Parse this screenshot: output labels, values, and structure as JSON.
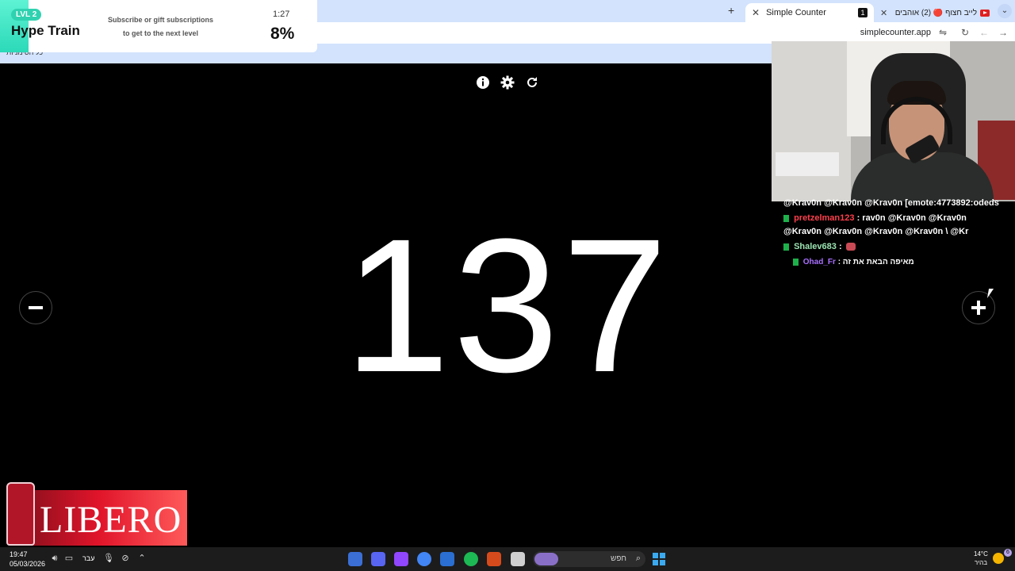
{
  "browser": {
    "new_tab_icon": "plus-icon",
    "tabs": [
      {
        "title": "Simple Counter",
        "favicon": "1"
      },
      {
        "title": "לייב חצוף 🔴 (2) אוהבים"
      }
    ],
    "url": "simplecounter.app",
    "bookmark": "כל הסימניות"
  },
  "hype_train": {
    "level": "LVL 2",
    "title": "Hype Train",
    "subtitle_line1": "Subscribe or gift subscriptions",
    "subtitle_line2": "to get to the next level",
    "timer": "1:27",
    "progress": "8%"
  },
  "counter": {
    "value": "137",
    "decrement_icon": "minus-icon",
    "increment_icon": "plus-icon",
    "toolbar_icons": [
      "info-icon",
      "gear-icon",
      "refresh-icon"
    ]
  },
  "chat": {
    "line1": "@Krav0n   @Krav0n   @Krav0n [emote:4773892:odeds",
    "line2_user": "pretzelman123",
    "line2_msg": ": rav0n   @Krav0n   @Krav0n  ",
    "line3": "@Krav0n   @Krav0n   @Krav0n   @Krav0n \\   @Kr",
    "line4_user": "Shalev683",
    "line4_msg": " : ",
    "line5_user": "Ohad_Fr",
    "line5_msg": " : מאיפה הבאת את זה"
  },
  "sponsor": {
    "brand": "LIBERO"
  },
  "taskbar": {
    "time": "19:47",
    "date": "05/03/2026",
    "lang": "עבר",
    "search_label": "חפש",
    "temp": "14°C",
    "weather_label": "בהיר",
    "notif_count": "6"
  },
  "colors": {
    "accent_teal": "#2fd2b0",
    "tab_bar": "#d3e3fd",
    "chat_red_user": "#ff3f4c",
    "chat_purple_user": "#a970ff"
  }
}
